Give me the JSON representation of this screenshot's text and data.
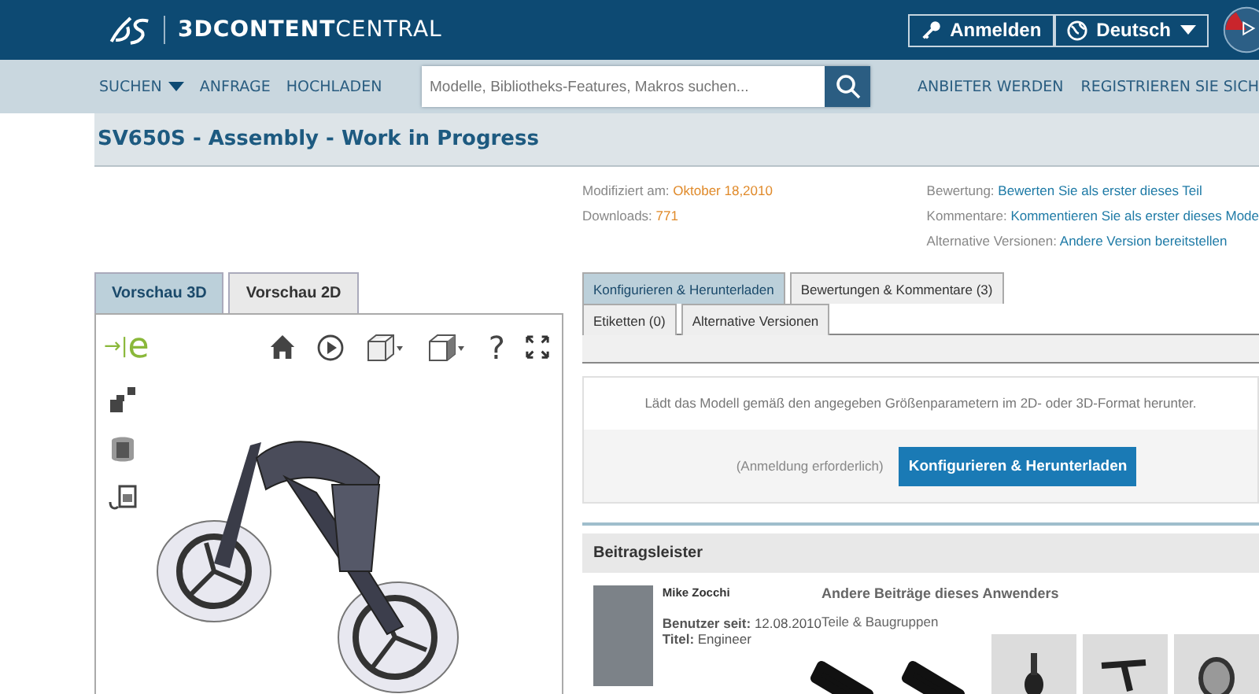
{
  "header": {
    "logo_bold": "3DCONTENT",
    "logo_light": "CENTRAL",
    "login": "Anmelden",
    "language": "Deutsch"
  },
  "nav": {
    "items": [
      {
        "label": "SUCHEN",
        "dropdown": true
      },
      {
        "label": "ANFRAGE",
        "dropdown": false
      },
      {
        "label": "HOCHLADEN",
        "dropdown": false
      }
    ],
    "search": {
      "placeholder": "Modelle, Bibliotheks-Features, Makros suchen..."
    },
    "right_links": [
      "ANBIETER WERDEN",
      "REGISTRIEREN SIE SICH"
    ]
  },
  "title": "SV650S - Assembly - Work in Progress",
  "meta_left": [
    {
      "label": "Modifiziert am:",
      "value": "Oktober 18,2010"
    },
    {
      "label": "Downloads:",
      "value": "771"
    }
  ],
  "meta_right": [
    {
      "label": "Bewertung:",
      "link": "Bewerten Sie als erster dieses Teil"
    },
    {
      "label": "Kommentare:",
      "link": "Kommentieren Sie als erster dieses Mode"
    },
    {
      "label": "Alternative Versionen:",
      "link": "Andere Version bereitstellen"
    }
  ],
  "preview_tabs": [
    {
      "label": "Vorschau 3D",
      "selected": true
    },
    {
      "label": "Vorschau 2D",
      "selected": false
    }
  ],
  "viewer": {
    "logo_arrow": "→|",
    "logo_letter": "e",
    "toolbar": [
      {
        "kind": "home"
      },
      {
        "kind": "play"
      },
      {
        "kind": "view"
      },
      {
        "kind": "display"
      },
      {
        "kind": "help",
        "glyph": "?"
      },
      {
        "kind": "fullscreen"
      }
    ],
    "side_tools": [
      {
        "kind": "explode"
      },
      {
        "kind": "section"
      },
      {
        "kind": "measure"
      }
    ]
  },
  "detail_tabs": [
    {
      "label": "Konfigurieren & Herunterladen",
      "selected": true
    },
    {
      "label": "Bewertungen & Kommentare (3)",
      "selected": false
    },
    {
      "label": "Etiketten (0)",
      "selected": false
    },
    {
      "label": "Alternative Versionen",
      "selected": false
    }
  ],
  "download": {
    "description": "Lädt das Modell gemäß den angegeben Größenparametern im 2D- oder 3D-Format herunter.",
    "note": "(Anmeldung erforderlich)",
    "button": "Konfigurieren & Herunterladen"
  },
  "contributor": {
    "heading": "Beitragsleister",
    "name": "Mike Zocchi",
    "since": "**Benutzer seit:** 12.08.2010",
    "role": "**Titel:** Engineer",
    "others_heading": "Andere Beiträge dieses Anwenders",
    "category": "Teile & Baugruppen",
    "thumbnails": [
      {
        "kind": "grip"
      },
      {
        "kind": "grip"
      },
      {
        "kind": "knob"
      },
      {
        "kind": "lever"
      },
      {
        "kind": "cylinder"
      }
    ]
  }
}
